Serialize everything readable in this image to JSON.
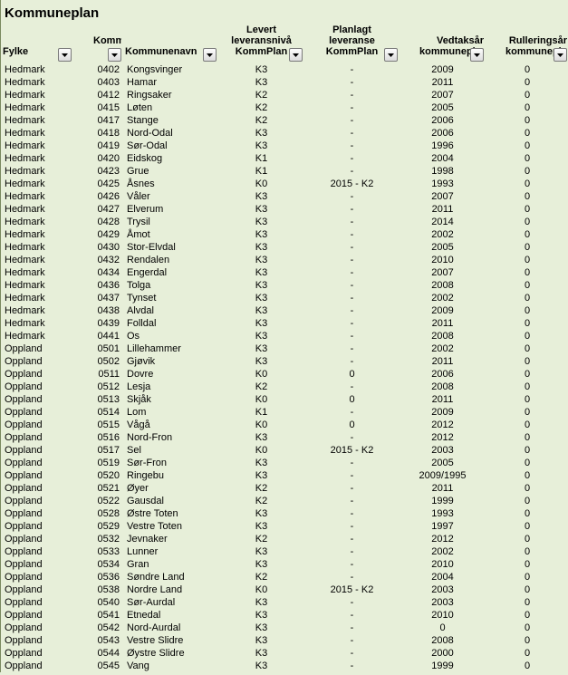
{
  "title": "Kommuneplan",
  "headers": {
    "fylke": "Fylke",
    "kommnr": "Komm nr",
    "kommunenavn": "Kommunenavn",
    "levert": "Levert leveransnivå KommPlan",
    "planlagt": "Planlagt leveranse KommPlan",
    "vedtak": "Vedtaksår kommuneplan",
    "rull": "Rulleringsår kommuneplan"
  },
  "rows": [
    {
      "fylke": "Hedmark",
      "nr": "0402",
      "navn": "Kongsvinger",
      "lev": "K3",
      "plan": "-",
      "vedtak": "2009",
      "rull": "0"
    },
    {
      "fylke": "Hedmark",
      "nr": "0403",
      "navn": "Hamar",
      "lev": "K3",
      "plan": "-",
      "vedtak": "2011",
      "rull": "0"
    },
    {
      "fylke": "Hedmark",
      "nr": "0412",
      "navn": "Ringsaker",
      "lev": "K2",
      "plan": "-",
      "vedtak": "2007",
      "rull": "0"
    },
    {
      "fylke": "Hedmark",
      "nr": "0415",
      "navn": "Løten",
      "lev": "K2",
      "plan": "-",
      "vedtak": "2005",
      "rull": "0"
    },
    {
      "fylke": "Hedmark",
      "nr": "0417",
      "navn": "Stange",
      "lev": "K2",
      "plan": "-",
      "vedtak": "2006",
      "rull": "0"
    },
    {
      "fylke": "Hedmark",
      "nr": "0418",
      "navn": "Nord-Odal",
      "lev": "K3",
      "plan": "-",
      "vedtak": "2006",
      "rull": "0"
    },
    {
      "fylke": "Hedmark",
      "nr": "0419",
      "navn": "Sør-Odal",
      "lev": "K3",
      "plan": "-",
      "vedtak": "1996",
      "rull": "0"
    },
    {
      "fylke": "Hedmark",
      "nr": "0420",
      "navn": "Eidskog",
      "lev": "K1",
      "plan": "-",
      "vedtak": "2004",
      "rull": "0"
    },
    {
      "fylke": "Hedmark",
      "nr": "0423",
      "navn": "Grue",
      "lev": "K1",
      "plan": "-",
      "vedtak": "1998",
      "rull": "0"
    },
    {
      "fylke": "Hedmark",
      "nr": "0425",
      "navn": "Åsnes",
      "lev": "K0",
      "plan": "2015 - K2",
      "vedtak": "1993",
      "rull": "0"
    },
    {
      "fylke": "Hedmark",
      "nr": "0426",
      "navn": "Våler",
      "lev": "K3",
      "plan": "-",
      "vedtak": "2007",
      "rull": "0"
    },
    {
      "fylke": "Hedmark",
      "nr": "0427",
      "navn": "Elverum",
      "lev": "K3",
      "plan": "-",
      "vedtak": "2011",
      "rull": "0"
    },
    {
      "fylke": "Hedmark",
      "nr": "0428",
      "navn": "Trysil",
      "lev": "K3",
      "plan": "-",
      "vedtak": "2014",
      "rull": "0"
    },
    {
      "fylke": "Hedmark",
      "nr": "0429",
      "navn": "Åmot",
      "lev": "K3",
      "plan": "-",
      "vedtak": "2002",
      "rull": "0"
    },
    {
      "fylke": "Hedmark",
      "nr": "0430",
      "navn": "Stor-Elvdal",
      "lev": "K3",
      "plan": "-",
      "vedtak": "2005",
      "rull": "0"
    },
    {
      "fylke": "Hedmark",
      "nr": "0432",
      "navn": "Rendalen",
      "lev": "K3",
      "plan": "-",
      "vedtak": "2010",
      "rull": "0"
    },
    {
      "fylke": "Hedmark",
      "nr": "0434",
      "navn": "Engerdal",
      "lev": "K3",
      "plan": "-",
      "vedtak": "2007",
      "rull": "0"
    },
    {
      "fylke": "Hedmark",
      "nr": "0436",
      "navn": "Tolga",
      "lev": "K3",
      "plan": "-",
      "vedtak": "2008",
      "rull": "0"
    },
    {
      "fylke": "Hedmark",
      "nr": "0437",
      "navn": "Tynset",
      "lev": "K3",
      "plan": "-",
      "vedtak": "2002",
      "rull": "0"
    },
    {
      "fylke": "Hedmark",
      "nr": "0438",
      "navn": "Alvdal",
      "lev": "K3",
      "plan": "-",
      "vedtak": "2009",
      "rull": "0"
    },
    {
      "fylke": "Hedmark",
      "nr": "0439",
      "navn": "Folldal",
      "lev": "K3",
      "plan": "-",
      "vedtak": "2011",
      "rull": "0"
    },
    {
      "fylke": "Hedmark",
      "nr": "0441",
      "navn": "Os",
      "lev": "K3",
      "plan": "-",
      "vedtak": "2008",
      "rull": "0"
    },
    {
      "fylke": "Oppland",
      "nr": "0501",
      "navn": "Lillehammer",
      "lev": "K3",
      "plan": "-",
      "vedtak": "2002",
      "rull": "0"
    },
    {
      "fylke": "Oppland",
      "nr": "0502",
      "navn": "Gjøvik",
      "lev": "K3",
      "plan": "-",
      "vedtak": "2011",
      "rull": "0"
    },
    {
      "fylke": "Oppland",
      "nr": "0511",
      "navn": "Dovre",
      "lev": "K0",
      "plan": "0",
      "vedtak": "2006",
      "rull": "0"
    },
    {
      "fylke": "Oppland",
      "nr": "0512",
      "navn": "Lesja",
      "lev": "K2",
      "plan": "-",
      "vedtak": "2008",
      "rull": "0"
    },
    {
      "fylke": "Oppland",
      "nr": "0513",
      "navn": "Skjåk",
      "lev": "K0",
      "plan": "0",
      "vedtak": "2011",
      "rull": "0"
    },
    {
      "fylke": "Oppland",
      "nr": "0514",
      "navn": "Lom",
      "lev": "K1",
      "plan": "-",
      "vedtak": "2009",
      "rull": "0"
    },
    {
      "fylke": "Oppland",
      "nr": "0515",
      "navn": "Vågå",
      "lev": "K0",
      "plan": "0",
      "vedtak": "2012",
      "rull": "0"
    },
    {
      "fylke": "Oppland",
      "nr": "0516",
      "navn": "Nord-Fron",
      "lev": "K3",
      "plan": "-",
      "vedtak": "2012",
      "rull": "0"
    },
    {
      "fylke": "Oppland",
      "nr": "0517",
      "navn": "Sel",
      "lev": "K0",
      "plan": "2015 - K2",
      "vedtak": "2003",
      "rull": "0"
    },
    {
      "fylke": "Oppland",
      "nr": "0519",
      "navn": "Sør-Fron",
      "lev": "K3",
      "plan": "-",
      "vedtak": "2005",
      "rull": "0"
    },
    {
      "fylke": "Oppland",
      "nr": "0520",
      "navn": "Ringebu",
      "lev": "K3",
      "plan": "-",
      "vedtak": "2009/1995",
      "rull": "0"
    },
    {
      "fylke": "Oppland",
      "nr": "0521",
      "navn": "Øyer",
      "lev": "K2",
      "plan": "-",
      "vedtak": "2011",
      "rull": "0"
    },
    {
      "fylke": "Oppland",
      "nr": "0522",
      "navn": "Gausdal",
      "lev": "K2",
      "plan": "-",
      "vedtak": "1999",
      "rull": "0"
    },
    {
      "fylke": "Oppland",
      "nr": "0528",
      "navn": "Østre Toten",
      "lev": "K3",
      "plan": "-",
      "vedtak": "1993",
      "rull": "0"
    },
    {
      "fylke": "Oppland",
      "nr": "0529",
      "navn": "Vestre Toten",
      "lev": "K3",
      "plan": "-",
      "vedtak": "1997",
      "rull": "0"
    },
    {
      "fylke": "Oppland",
      "nr": "0532",
      "navn": "Jevnaker",
      "lev": "K2",
      "plan": "-",
      "vedtak": "2012",
      "rull": "0"
    },
    {
      "fylke": "Oppland",
      "nr": "0533",
      "navn": "Lunner",
      "lev": "K3",
      "plan": "-",
      "vedtak": "2002",
      "rull": "0"
    },
    {
      "fylke": "Oppland",
      "nr": "0534",
      "navn": "Gran",
      "lev": "K3",
      "plan": "-",
      "vedtak": "2010",
      "rull": "0"
    },
    {
      "fylke": "Oppland",
      "nr": "0536",
      "navn": "Søndre Land",
      "lev": "K2",
      "plan": "-",
      "vedtak": "2004",
      "rull": "0"
    },
    {
      "fylke": "Oppland",
      "nr": "0538",
      "navn": "Nordre Land",
      "lev": "K0",
      "plan": "2015 - K2",
      "vedtak": "2003",
      "rull": "0"
    },
    {
      "fylke": "Oppland",
      "nr": "0540",
      "navn": "Sør-Aurdal",
      "lev": "K3",
      "plan": "-",
      "vedtak": "2003",
      "rull": "0"
    },
    {
      "fylke": "Oppland",
      "nr": "0541",
      "navn": "Etnedal",
      "lev": "K3",
      "plan": "-",
      "vedtak": "2010",
      "rull": "0"
    },
    {
      "fylke": "Oppland",
      "nr": "0542",
      "navn": "Nord-Aurdal",
      "lev": "K3",
      "plan": "-",
      "vedtak": "0",
      "rull": "0"
    },
    {
      "fylke": "Oppland",
      "nr": "0543",
      "navn": "Vestre Slidre",
      "lev": "K3",
      "plan": "-",
      "vedtak": "2008",
      "rull": "0"
    },
    {
      "fylke": "Oppland",
      "nr": "0544",
      "navn": "Øystre Slidre",
      "lev": "K3",
      "plan": "-",
      "vedtak": "2000",
      "rull": "0"
    },
    {
      "fylke": "Oppland",
      "nr": "0545",
      "navn": "Vang",
      "lev": "K3",
      "plan": "-",
      "vedtak": "1999",
      "rull": "0"
    }
  ]
}
